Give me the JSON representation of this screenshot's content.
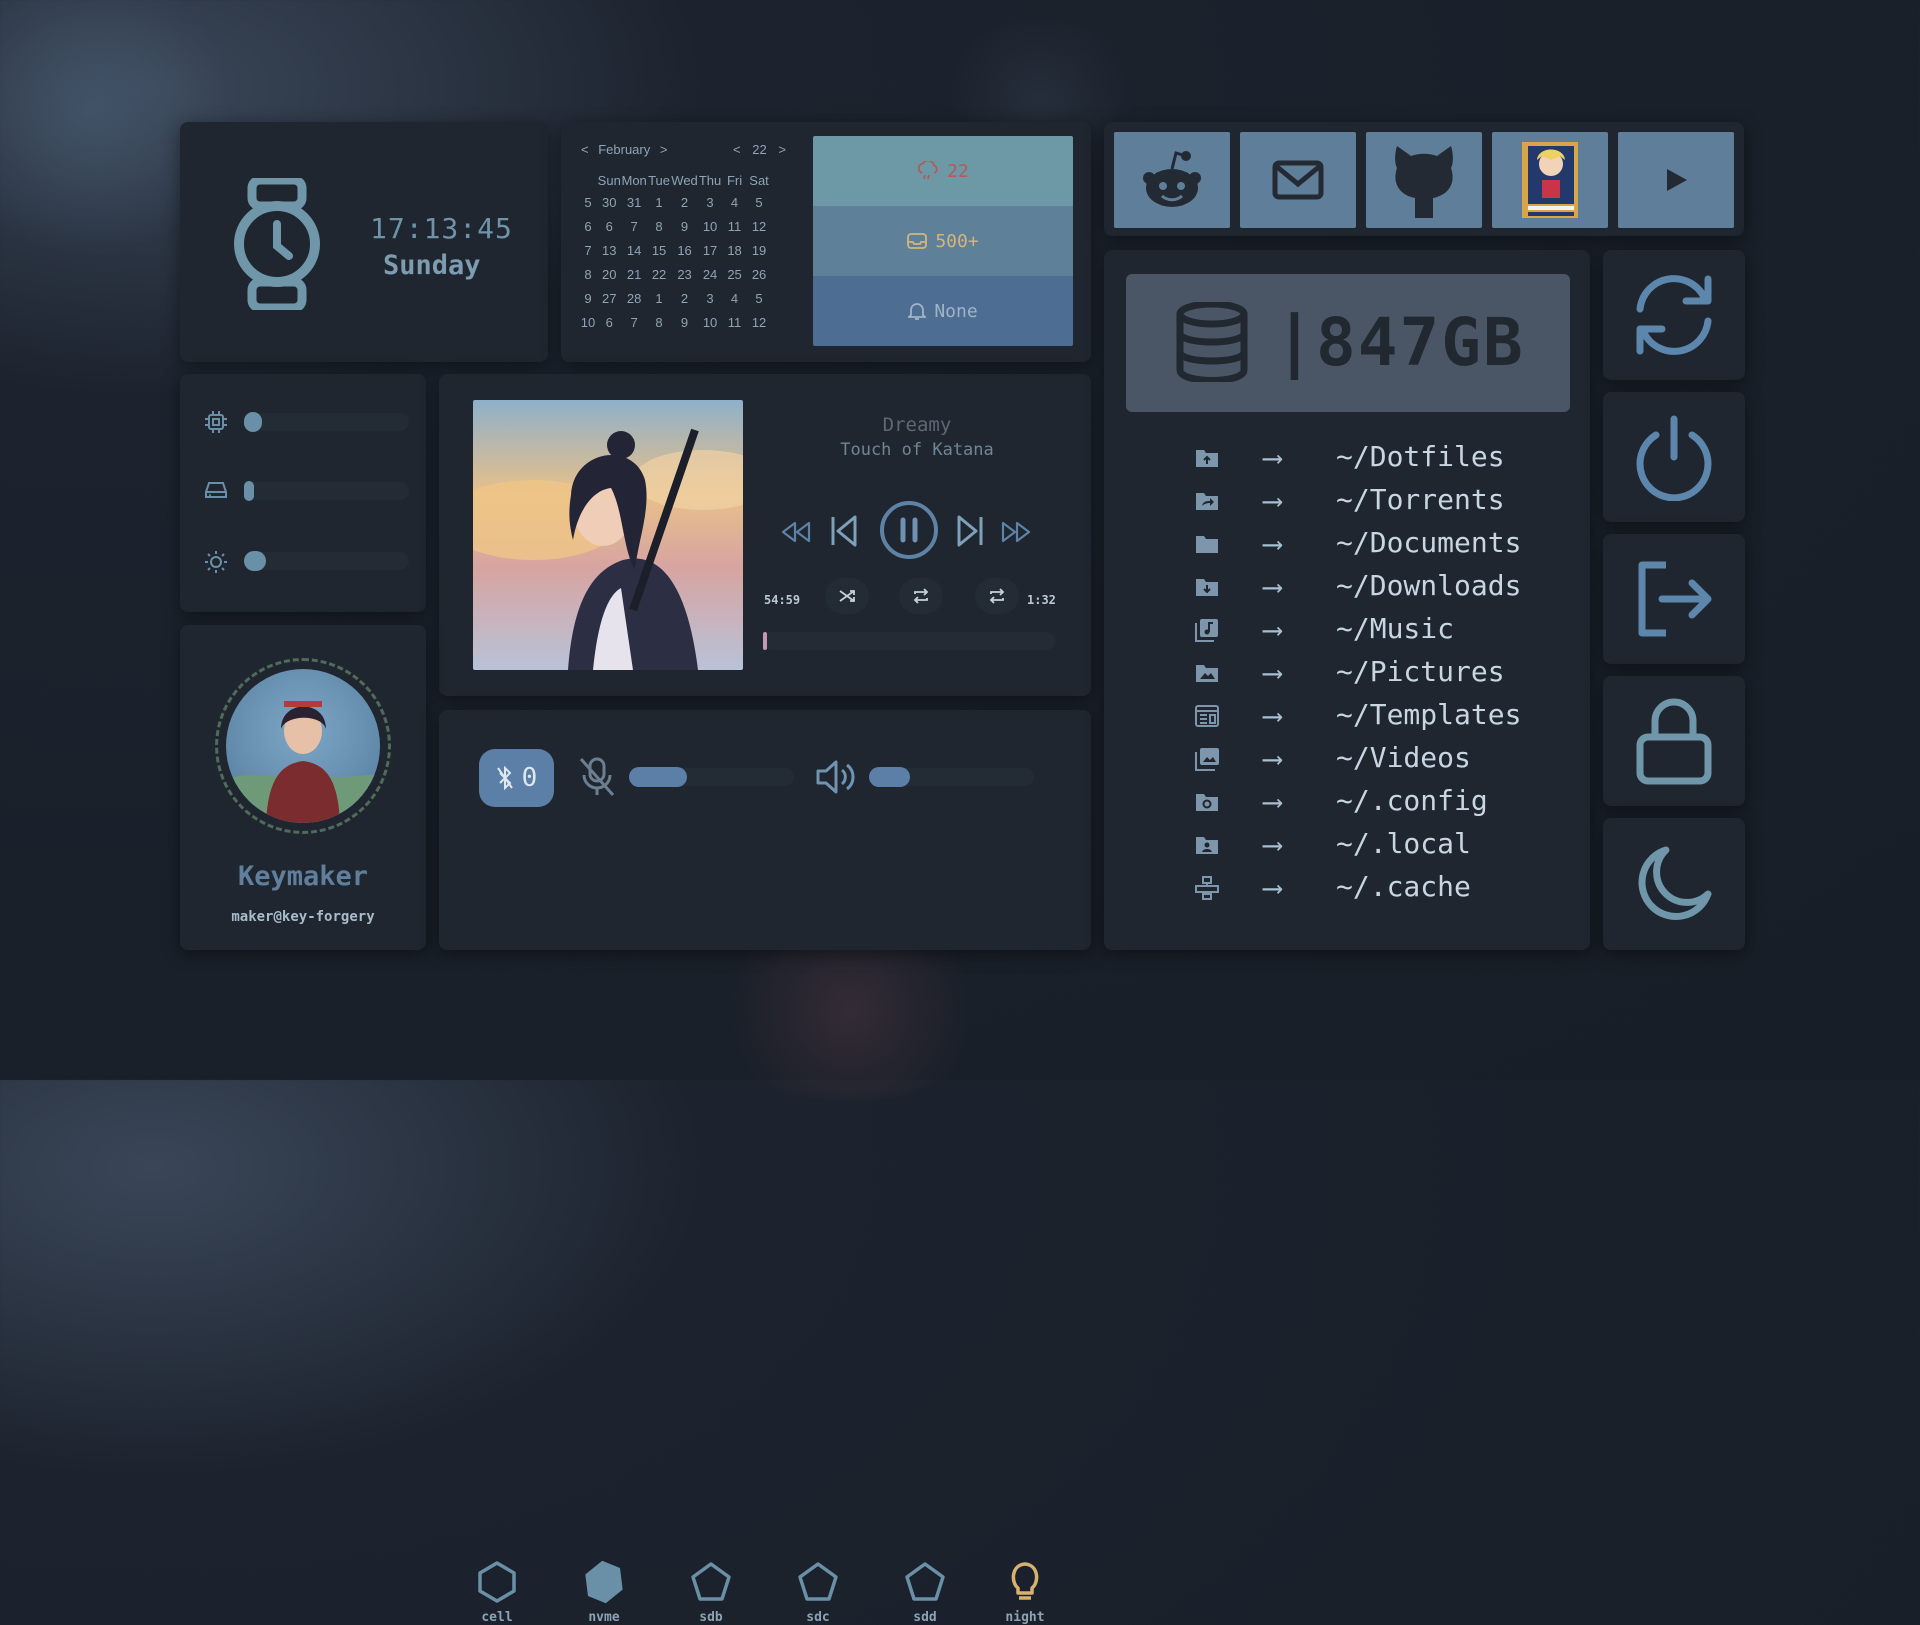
{
  "clock": {
    "time": "17:13:45",
    "day": "Sunday"
  },
  "calendar": {
    "month": "February",
    "year_short": "22",
    "prev_month": "<",
    "next_month": ">",
    "prev_year": "<",
    "next_year": ">",
    "weekdays": [
      "Sun",
      "Mon",
      "Tue",
      "Wed",
      "Thu",
      "Fri",
      "Sat"
    ],
    "rows": [
      {
        "wk": "5",
        "days": [
          "30",
          "31",
          "1",
          "2",
          "3",
          "4",
          "5"
        ]
      },
      {
        "wk": "6",
        "days": [
          "6",
          "7",
          "8",
          "9",
          "10",
          "11",
          "12"
        ]
      },
      {
        "wk": "7",
        "days": [
          "13",
          "14",
          "15",
          "16",
          "17",
          "18",
          "19"
        ]
      },
      {
        "wk": "8",
        "days": [
          "20",
          "21",
          "22",
          "23",
          "24",
          "25",
          "26"
        ]
      },
      {
        "wk": "9",
        "days": [
          "27",
          "28",
          "1",
          "2",
          "3",
          "4",
          "5"
        ]
      },
      {
        "wk": "10",
        "days": [
          "6",
          "7",
          "8",
          "9",
          "10",
          "11",
          "12"
        ]
      }
    ]
  },
  "status": {
    "weather": "22",
    "inbox": "500+",
    "notifications": "None"
  },
  "sliders": {
    "cpu_level": 0.06,
    "disk_level": 0.03,
    "brightness_level": 0.1
  },
  "player": {
    "title": "Dreamy",
    "artist": "Touch of Katana",
    "elapsed": "54:59",
    "remaining": "1:32",
    "progress": 0.01
  },
  "controls": {
    "bluetooth_count": "0",
    "mic_level": 0.35,
    "volume_level": 0.25
  },
  "devices": [
    {
      "label": "cell",
      "icon": "hexagon-outline-icon"
    },
    {
      "label": "nvme",
      "icon": "hexagon-filled-icon"
    },
    {
      "label": "sdb",
      "icon": "pentagon-icon"
    },
    {
      "label": "sdc",
      "icon": "pentagon-icon"
    },
    {
      "label": "sdd",
      "icon": "pentagon-icon"
    },
    {
      "label": "night",
      "icon": "lightbulb-icon"
    }
  ],
  "profile": {
    "name": "Keymaker",
    "host": "maker@key-forgery"
  },
  "apps": [
    "reddit-icon",
    "mail-icon",
    "github-icon",
    "manga-reader-icon",
    "play-icon"
  ],
  "disk": {
    "free": "847GB",
    "separator": "|"
  },
  "folders": [
    {
      "path": "~/Dotfiles",
      "icon": "folder-upload-icon"
    },
    {
      "path": "~/Torrents",
      "icon": "folder-share-icon"
    },
    {
      "path": "~/Documents",
      "icon": "folder-icon"
    },
    {
      "path": "~/Downloads",
      "icon": "folder-download-icon"
    },
    {
      "path": "~/Music",
      "icon": "music-library-icon"
    },
    {
      "path": "~/Pictures",
      "icon": "folder-image-icon"
    },
    {
      "path": "~/Templates",
      "icon": "template-icon"
    },
    {
      "path": "~/Videos",
      "icon": "image-multiple-icon"
    },
    {
      "path": "~/.config",
      "icon": "folder-settings-icon"
    },
    {
      "path": "~/.local",
      "icon": "folder-account-icon"
    },
    {
      "path": "~/.cache",
      "icon": "cache-icon"
    }
  ],
  "arrow": "⟶",
  "power": [
    "refresh-icon",
    "power-icon",
    "logout-icon",
    "lock-icon",
    "sleep-icon"
  ],
  "colors": {
    "accent": "#6a90a8",
    "panel": "#1f262f",
    "weather_bg": "#6d98a6",
    "inbox_bg": "#5e8099",
    "notif_bg": "#4d6d93"
  }
}
